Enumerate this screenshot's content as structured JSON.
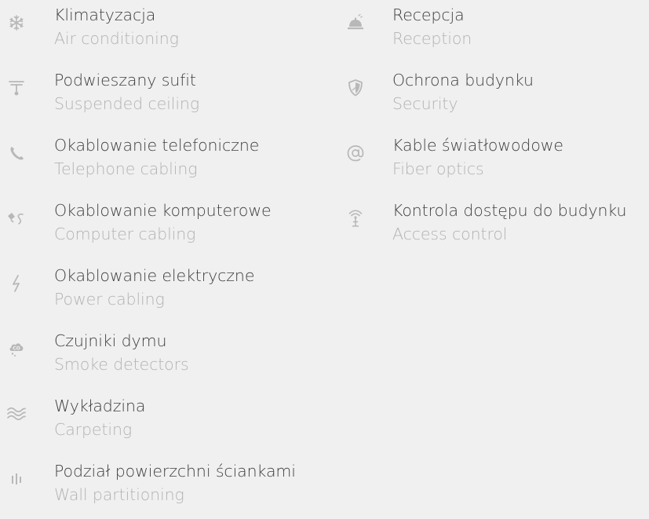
{
  "left": {
    "items": [
      {
        "icon": "snowflake-icon",
        "title": "Klimatyzacja",
        "subtitle": "Air conditioning"
      },
      {
        "icon": "ceiling-lamp-icon",
        "title": "Podwieszany sufit",
        "subtitle": "Suspended ceiling"
      },
      {
        "icon": "phone-icon",
        "title": "Okablowanie telefoniczne",
        "subtitle": "Telephone cabling"
      },
      {
        "icon": "network-cable-icon",
        "title": "Okablowanie komputerowe",
        "subtitle": "Computer cabling"
      },
      {
        "icon": "lightning-icon",
        "title": "Okablowanie elektryczne",
        "subtitle": "Power cabling"
      },
      {
        "icon": "smoke-detector-icon",
        "title": "Czujniki dymu",
        "subtitle": "Smoke detectors"
      },
      {
        "icon": "waves-icon",
        "title": "Wykładzina",
        "subtitle": "Carpeting"
      },
      {
        "icon": "partition-icon",
        "title": "Podział powierzchni ściankami",
        "subtitle": "Wall partitioning"
      }
    ]
  },
  "right": {
    "items": [
      {
        "icon": "reception-bell-icon",
        "title": "Recepcja",
        "subtitle": "Reception"
      },
      {
        "icon": "shield-icon",
        "title": "Ochrona budynku",
        "subtitle": "Security"
      },
      {
        "icon": "at-sign-icon",
        "title": "Kable światłowodowe",
        "subtitle": "Fiber optics"
      },
      {
        "icon": "antenna-icon",
        "title": "Kontrola dostępu do budynku",
        "subtitle": "Access control"
      }
    ]
  },
  "colors": {
    "background": "#f0f0f0",
    "title": "#3f3f3f",
    "subtitle": "#b3b3b3",
    "icon": "#b8b8b8"
  }
}
